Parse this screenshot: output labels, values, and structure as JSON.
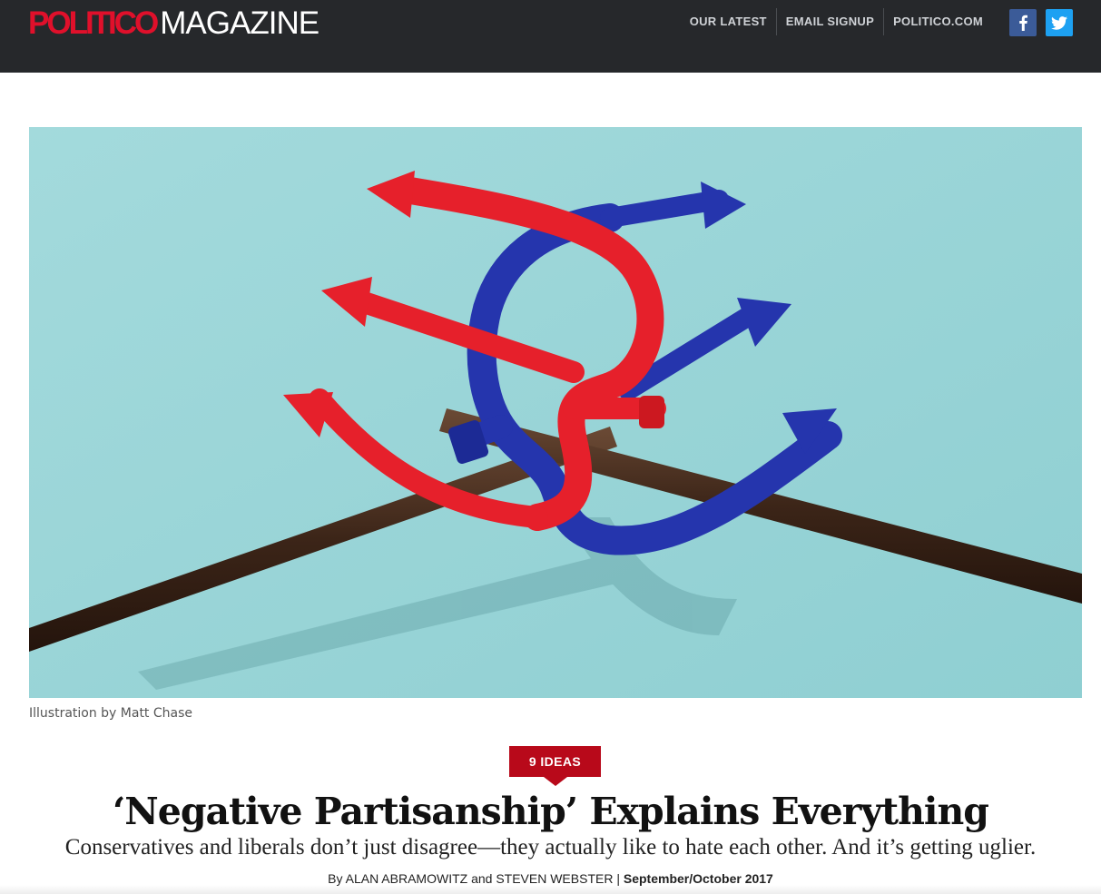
{
  "header": {
    "logo_part1": "POLITICO",
    "logo_part2": "MAGAZINE",
    "nav": [
      {
        "label": "OUR LATEST"
      },
      {
        "label": "EMAIL SIGNUP"
      },
      {
        "label": "POLITICO.COM"
      }
    ],
    "facebook_icon": "facebook-icon",
    "twitter_icon": "twitter-icon"
  },
  "hero": {
    "caption": "Illustration by Matt Chase"
  },
  "article": {
    "kicker": "9 IDEAS",
    "headline": "‘Negative Partisanship’ Explains Everything",
    "dek": "Conservatives and liberals don’t just disagree—they actually like to hate each other. And it’s getting uglier.",
    "byline_prefix": "By",
    "authors": "ALAN ABRAMOWITZ and STEVEN WEBSTER",
    "separator": "|",
    "date": "September/October 2017"
  },
  "colors": {
    "topbar": "#26282b",
    "brand_red": "#e0102b",
    "kicker_red": "#b8091a",
    "hero_bg": "#95d3d6",
    "fork_red": "#e8202a",
    "fork_blue": "#2233a8",
    "facebook": "#3b5b98",
    "twitter": "#1da1f2"
  }
}
